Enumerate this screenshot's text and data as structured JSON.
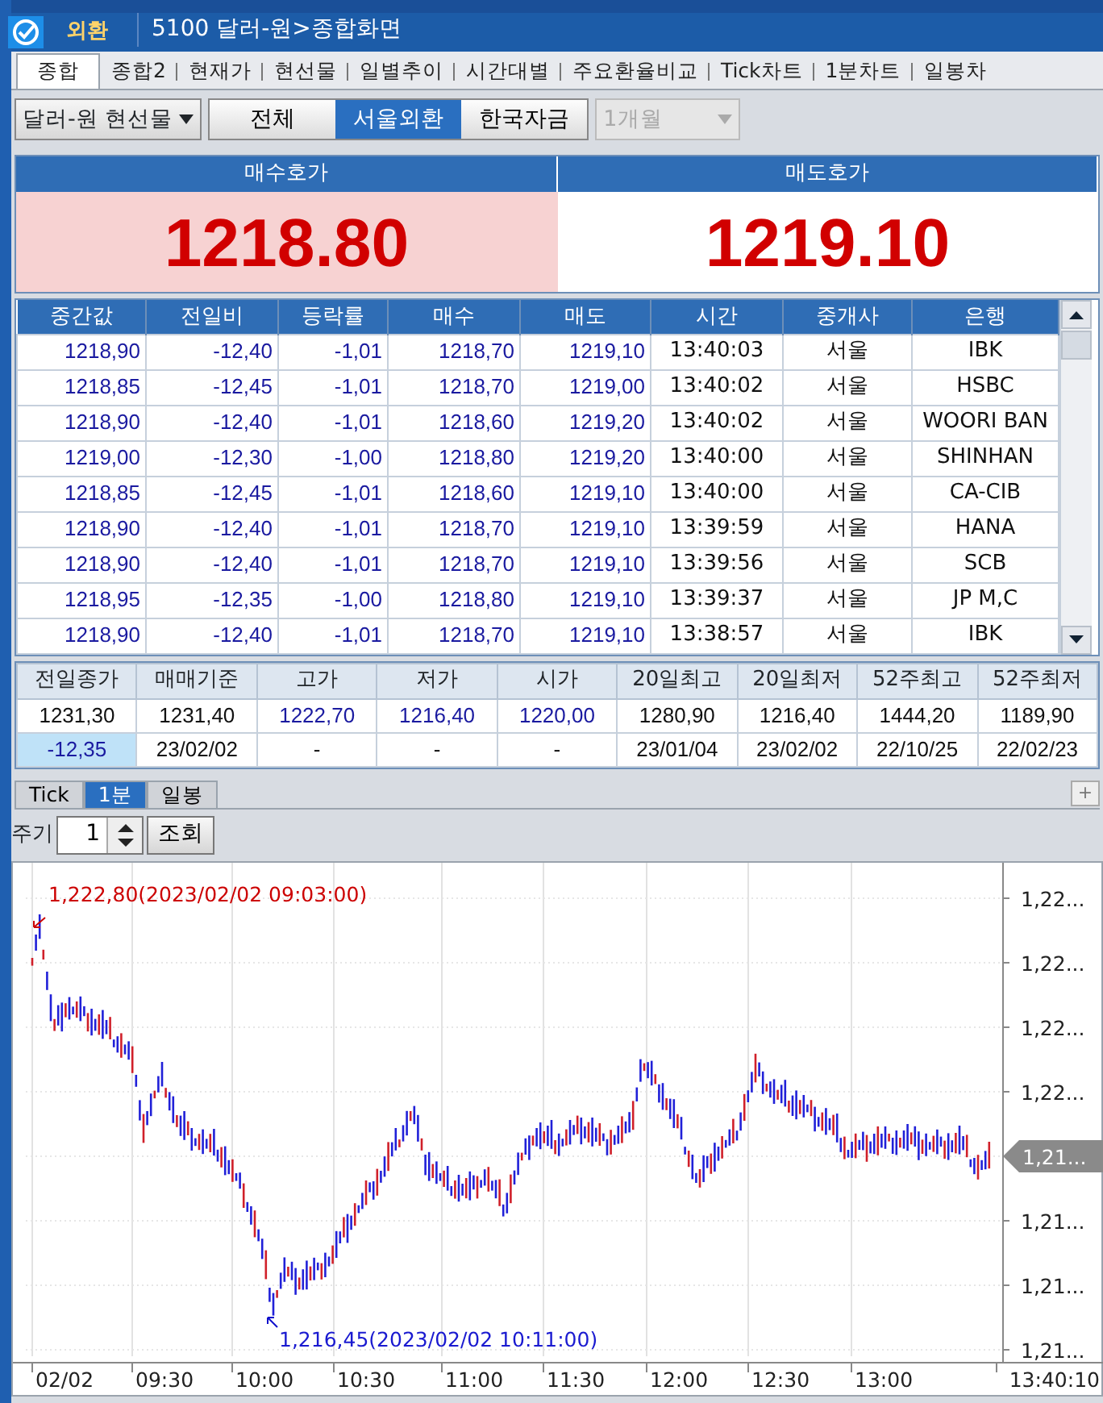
{
  "title_bar": {
    "badge": "외환",
    "title": "5100 달러-원>종합화면"
  },
  "tabs": [
    {
      "label": "종합",
      "selected": true
    },
    {
      "label": "종합2",
      "selected": false
    },
    {
      "label": "현재가",
      "selected": false
    },
    {
      "label": "현선물",
      "selected": false
    },
    {
      "label": "일별추이",
      "selected": false
    },
    {
      "label": "시간대별",
      "selected": false
    },
    {
      "label": "주요환율비교",
      "selected": false
    },
    {
      "label": "Tick차트",
      "selected": false
    },
    {
      "label": "1분차트",
      "selected": false
    },
    {
      "label": "일봉차",
      "selected": false
    }
  ],
  "toolbar": {
    "product": "달러-원 현선물",
    "segments": [
      {
        "label": "전체",
        "selected": false
      },
      {
        "label": "서울외환",
        "selected": true
      },
      {
        "label": "한국자금",
        "selected": false
      }
    ],
    "period": {
      "value": "1개월",
      "disabled": true
    }
  },
  "quote": {
    "bid_label": "매수호가",
    "bid": "1218.80",
    "ask_label": "매도호가",
    "ask": "1219.10"
  },
  "trades": {
    "columns": [
      "중간값",
      "전일비",
      "등락률",
      "매수",
      "매도",
      "시간",
      "중개사",
      "은행"
    ],
    "rows": [
      [
        "1218,90",
        "-12,40",
        "-1,01",
        "1218,70",
        "1219,10",
        "13:40:03",
        "서울",
        "IBK"
      ],
      [
        "1218,85",
        "-12,45",
        "-1,01",
        "1218,70",
        "1219,00",
        "13:40:02",
        "서울",
        "HSBC"
      ],
      [
        "1218,90",
        "-12,40",
        "-1,01",
        "1218,60",
        "1219,20",
        "13:40:02",
        "서울",
        "WOORI BAN"
      ],
      [
        "1219,00",
        "-12,30",
        "-1,00",
        "1218,80",
        "1219,20",
        "13:40:00",
        "서울",
        "SHINHAN"
      ],
      [
        "1218,85",
        "-12,45",
        "-1,01",
        "1218,60",
        "1219,10",
        "13:40:00",
        "서울",
        "CA-CIB"
      ],
      [
        "1218,90",
        "-12,40",
        "-1,01",
        "1218,70",
        "1219,10",
        "13:39:59",
        "서울",
        "HANA"
      ],
      [
        "1218,90",
        "-12,40",
        "-1,01",
        "1218,70",
        "1219,10",
        "13:39:56",
        "서울",
        "SCB"
      ],
      [
        "1218,95",
        "-12,35",
        "-1,00",
        "1218,80",
        "1219,10",
        "13:39:37",
        "서울",
        "JP M,C"
      ],
      [
        "1218,90",
        "-12,40",
        "-1,01",
        "1218,70",
        "1219,10",
        "13:38:57",
        "서울",
        "IBK"
      ]
    ]
  },
  "summary": {
    "columns": [
      "전일종가",
      "매매기준",
      "고가",
      "저가",
      "시가",
      "20일최고",
      "20일최저",
      "52주최고",
      "52주최저"
    ],
    "rows": [
      [
        {
          "text": "1231,30",
          "kind": "plain"
        },
        {
          "text": "1231,40",
          "kind": "plain"
        },
        {
          "text": "1222,70",
          "kind": "price"
        },
        {
          "text": "1216,40",
          "kind": "price"
        },
        {
          "text": "1220,00",
          "kind": "price"
        },
        {
          "text": "1280,90",
          "kind": "plain"
        },
        {
          "text": "1216,40",
          "kind": "plain"
        },
        {
          "text": "1444,20",
          "kind": "plain"
        },
        {
          "text": "1189,90",
          "kind": "plain"
        }
      ],
      [
        {
          "text": "-12,35",
          "kind": "change"
        },
        {
          "text": "23/02/02",
          "kind": "plain"
        },
        {
          "text": "-",
          "kind": "plain"
        },
        {
          "text": "-",
          "kind": "plain"
        },
        {
          "text": "-",
          "kind": "plain"
        },
        {
          "text": "23/01/04",
          "kind": "plain"
        },
        {
          "text": "23/02/02",
          "kind": "plain"
        },
        {
          "text": "22/10/25",
          "kind": "plain"
        },
        {
          "text": "22/02/23",
          "kind": "plain"
        }
      ]
    ]
  },
  "chart_tabs": [
    {
      "label": "Tick",
      "selected": false
    },
    {
      "label": "1분",
      "selected": true
    },
    {
      "label": "일봉",
      "selected": false
    }
  ],
  "chart_add": "+",
  "interval": {
    "label": "주기",
    "value": "1",
    "button": "조회"
  },
  "chart": {
    "high_label": "1,222,80(2023/02/02 09:03:00)",
    "low_label": "1,216,45(2023/02/02 10:11:00)",
    "y_labels": [
      "1,22...",
      "1,22...",
      "1,22...",
      "1,22...",
      "1,21...",
      "1,21...",
      "1,21..."
    ],
    "current_label": "1,21...",
    "x_labels": [
      "02/02",
      "09:30",
      "10:00",
      "10:30",
      "11:00",
      "11:30",
      "12:00",
      "12:30",
      "13:00",
      "13:40:10"
    ]
  }
}
